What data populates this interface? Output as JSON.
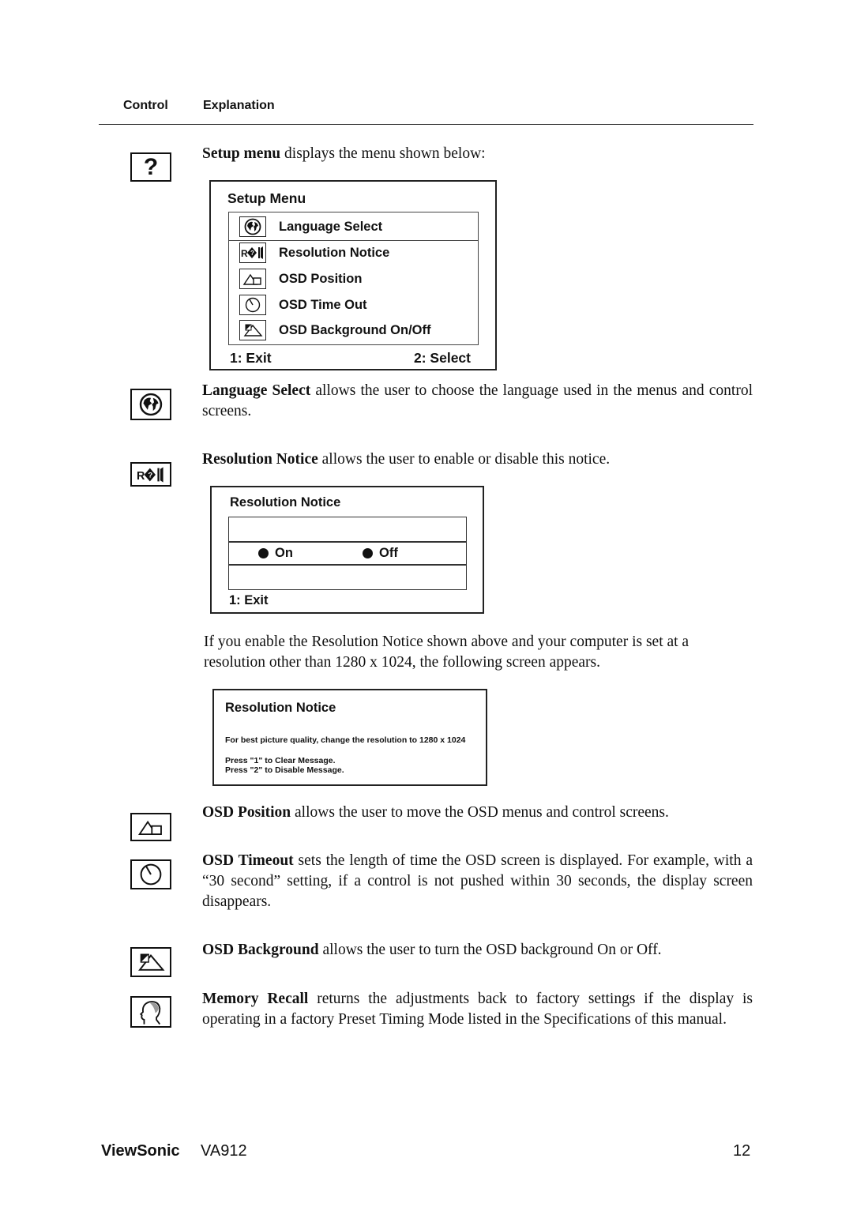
{
  "header": {
    "col_control": "Control",
    "col_explanation": "Explanation"
  },
  "sections": {
    "setup": {
      "icon": "question-mark-icon",
      "bold": "Setup menu",
      "text": " displays the menu shown below:"
    },
    "language": {
      "icon": "globe-icon",
      "bold": "Language Select",
      "text": " allows the user to choose the language used in the menus and control screens."
    },
    "resolution": {
      "icon": "resolution-notice-icon",
      "bold": "Resolution Notice",
      "text": " allows the user to enable or disable this notice."
    },
    "resolution_followup": {
      "text": "If you enable the Resolution Notice shown above and your computer is set at a resolution other than 1280 x 1024, the following screen appears."
    },
    "osd_position": {
      "icon": "osd-position-icon",
      "bold": "OSD Position",
      "text": " allows the user to move the OSD menus and control screens."
    },
    "osd_timeout": {
      "icon": "clock-icon",
      "bold": "OSD Timeout",
      "text": " sets the length of time the OSD screen is displayed. For example, with a “30 second” setting, if a control is not pushed within 30 seconds, the display screen disappears."
    },
    "osd_background": {
      "icon": "osd-background-icon",
      "bold": "OSD Background",
      "text": " allows the user to turn the OSD background On or Off."
    },
    "memory_recall": {
      "icon": "memory-recall-head-icon",
      "bold": "Memory Recall",
      "text": " returns the adjustments back to factory settings if the display is operating in a factory Preset Timing Mode listed in the Specifications of this manual."
    }
  },
  "setup_menu": {
    "title": "Setup Menu",
    "items": [
      {
        "label": "Language Select",
        "icon": "globe-icon",
        "selected": true
      },
      {
        "label": "Resolution Notice",
        "icon": "resolution-notice-icon",
        "selected": false
      },
      {
        "label": "OSD Position",
        "icon": "osd-position-icon",
        "selected": false
      },
      {
        "label": "OSD Time Out",
        "icon": "clock-icon",
        "selected": false
      },
      {
        "label": "OSD Background On/Off",
        "icon": "osd-background-icon",
        "selected": false
      }
    ],
    "footer_left": "1: Exit",
    "footer_right": "2: Select"
  },
  "resolution_menu": {
    "title": "Resolution Notice",
    "option_on": "On",
    "option_off": "Off",
    "footer_left": "1: Exit"
  },
  "resolution_message": {
    "title": "Resolution Notice",
    "line1": "For best picture quality, change the resolution to 1280 x 1024",
    "line2": "Press \"1\" to Clear Message.",
    "line3": "Press \"2\" to Disable Message."
  },
  "footer": {
    "brand": "ViewSonic",
    "model": "VA912",
    "page_number": "12"
  }
}
